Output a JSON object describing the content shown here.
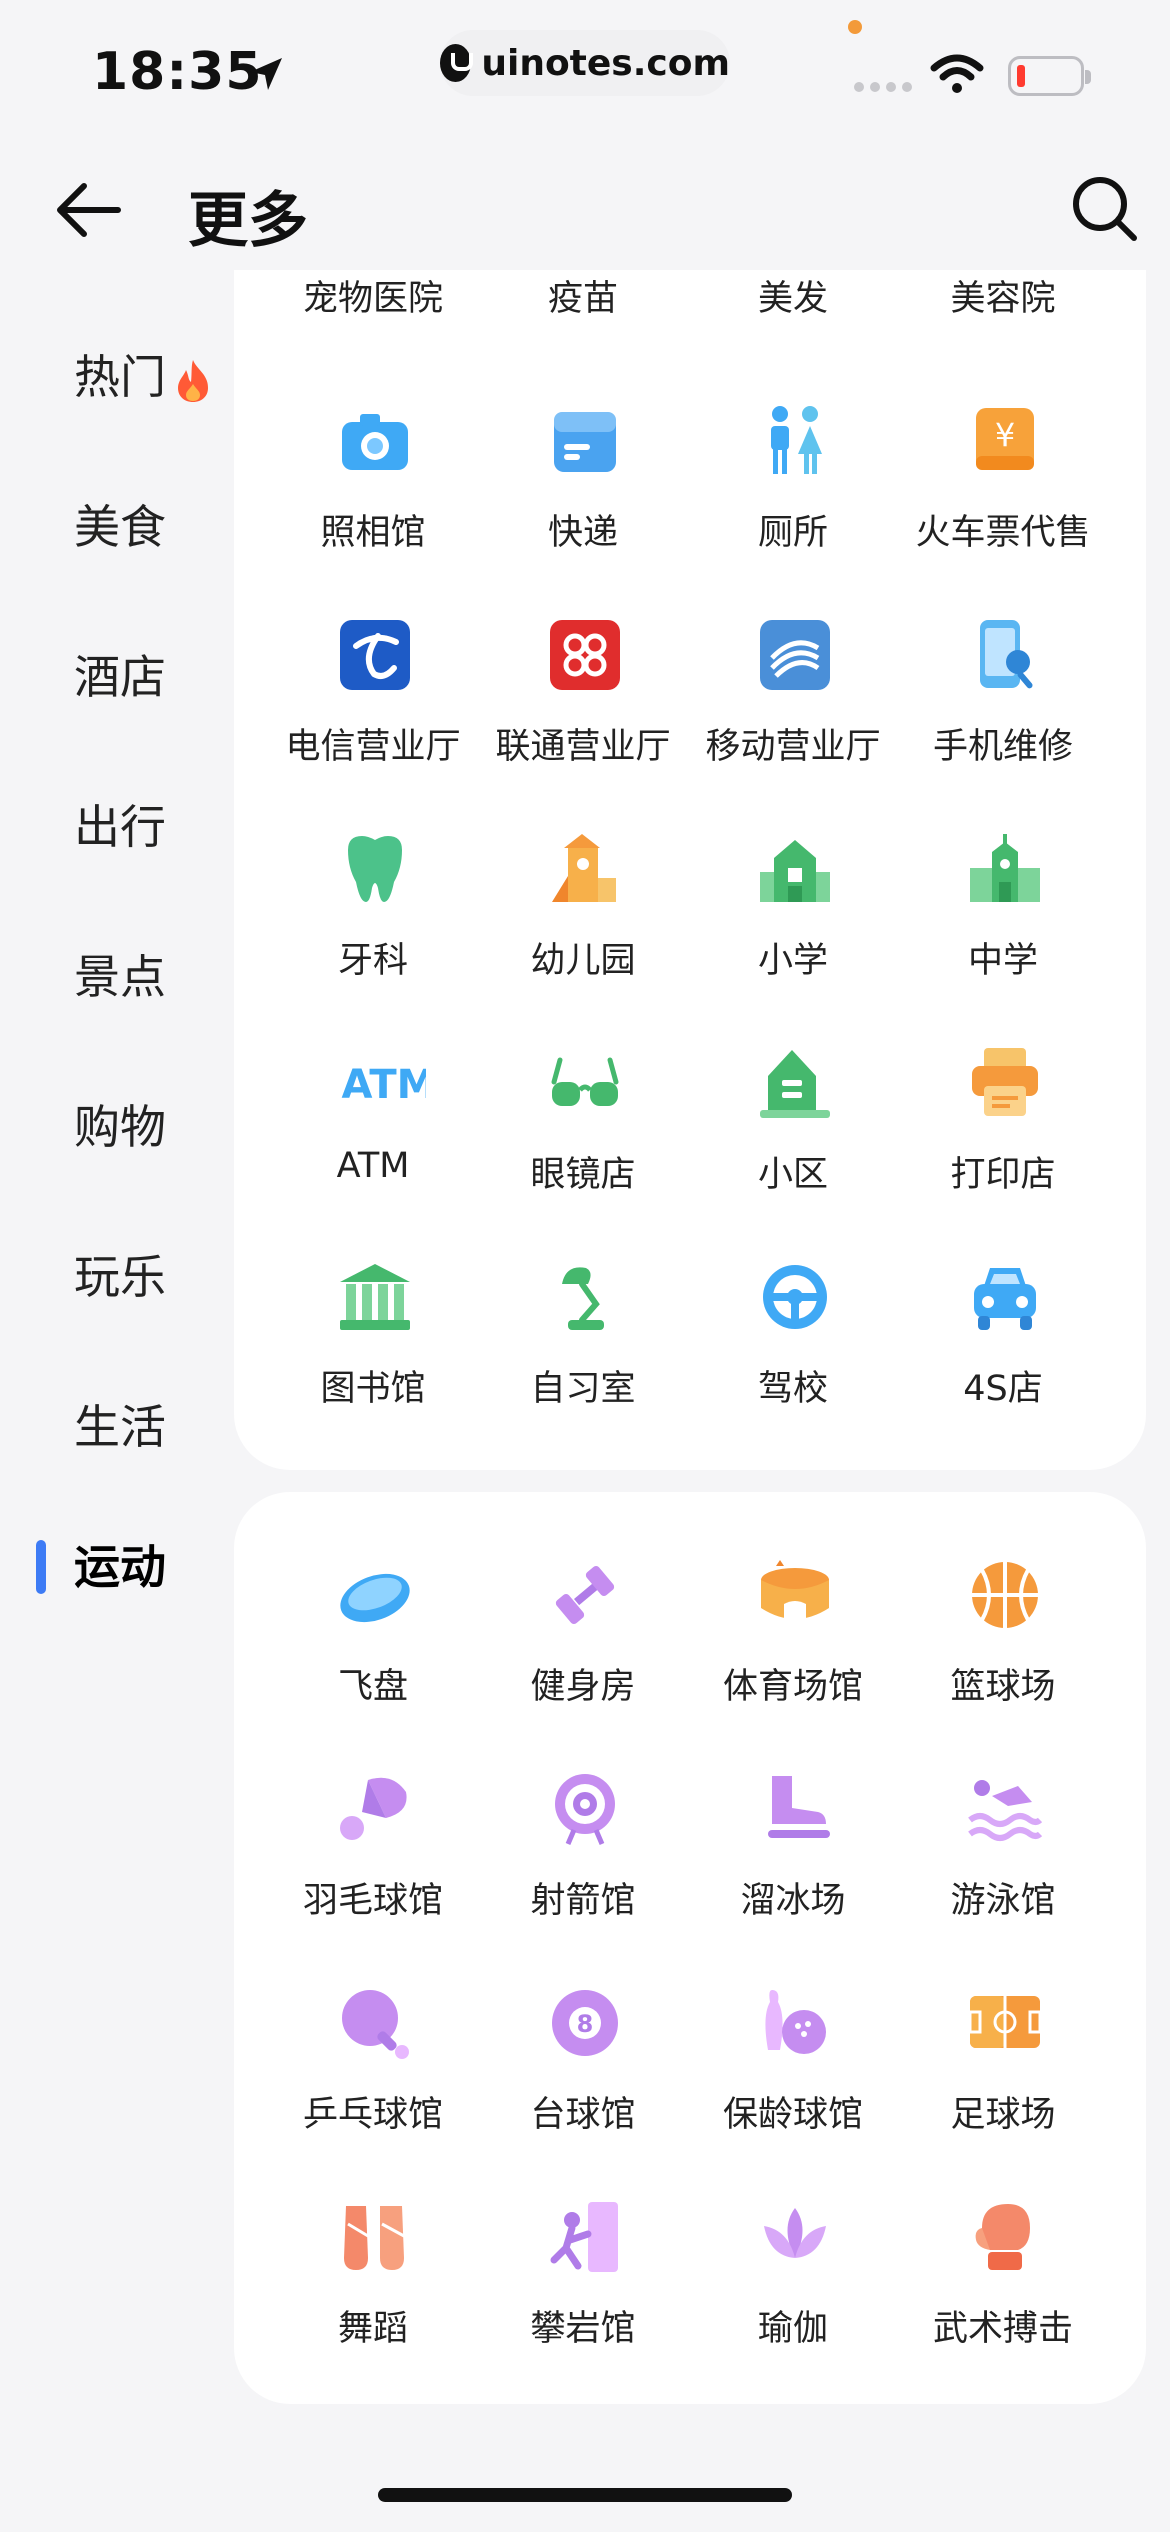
{
  "status_bar": {
    "time": "18:35",
    "url": "uinotes.com"
  },
  "header": {
    "title": "更多"
  },
  "sidebar": {
    "items": [
      {
        "label": "热门",
        "icon": "fire-icon"
      },
      {
        "label": "美食"
      },
      {
        "label": "酒店"
      },
      {
        "label": "出行"
      },
      {
        "label": "景点"
      },
      {
        "label": "购物"
      },
      {
        "label": "玩乐"
      },
      {
        "label": "生活"
      },
      {
        "label": "运动",
        "active": true
      }
    ]
  },
  "section_life": {
    "top_row": [
      "宠物医院",
      "疫苗",
      "美发",
      "美容院"
    ],
    "items": [
      {
        "label": "照相馆",
        "icon": "camera-icon"
      },
      {
        "label": "快递",
        "icon": "package-icon"
      },
      {
        "label": "厕所",
        "icon": "restroom-icon"
      },
      {
        "label": "火车票代售",
        "icon": "ticket-icon"
      },
      {
        "label": "电信营业厅",
        "icon": "telecom-icon"
      },
      {
        "label": "联通营业厅",
        "icon": "unicom-icon"
      },
      {
        "label": "移动营业厅",
        "icon": "mobile-icon"
      },
      {
        "label": "手机维修",
        "icon": "phone-repair-icon"
      },
      {
        "label": "牙科",
        "icon": "tooth-icon"
      },
      {
        "label": "幼儿园",
        "icon": "kindergarten-icon"
      },
      {
        "label": "小学",
        "icon": "primary-school-icon"
      },
      {
        "label": "中学",
        "icon": "middle-school-icon"
      },
      {
        "label": "ATM",
        "icon": "atm-icon"
      },
      {
        "label": "眼镜店",
        "icon": "glasses-icon"
      },
      {
        "label": "小区",
        "icon": "community-icon"
      },
      {
        "label": "打印店",
        "icon": "printer-icon"
      },
      {
        "label": "图书馆",
        "icon": "library-icon"
      },
      {
        "label": "自习室",
        "icon": "desk-lamp-icon"
      },
      {
        "label": "驾校",
        "icon": "steering-wheel-icon"
      },
      {
        "label": "4S店",
        "icon": "car-icon"
      }
    ]
  },
  "section_sports": {
    "items": [
      {
        "label": "飞盘",
        "icon": "frisbee-icon"
      },
      {
        "label": "健身房",
        "icon": "dumbbell-icon"
      },
      {
        "label": "体育场馆",
        "icon": "stadium-icon"
      },
      {
        "label": "篮球场",
        "icon": "basketball-icon"
      },
      {
        "label": "羽毛球馆",
        "icon": "shuttlecock-icon"
      },
      {
        "label": "射箭馆",
        "icon": "archery-target-icon"
      },
      {
        "label": "溜冰场",
        "icon": "skate-icon"
      },
      {
        "label": "游泳馆",
        "icon": "swimmer-icon"
      },
      {
        "label": "乒乓球馆",
        "icon": "ping-pong-icon"
      },
      {
        "label": "台球馆",
        "icon": "billiard-ball-icon"
      },
      {
        "label": "保龄球馆",
        "icon": "bowling-icon"
      },
      {
        "label": "足球场",
        "icon": "football-field-icon"
      },
      {
        "label": "舞蹈",
        "icon": "ballet-shoes-icon"
      },
      {
        "label": "攀岩馆",
        "icon": "climbing-icon"
      },
      {
        "label": "瑜伽",
        "icon": "lotus-icon"
      },
      {
        "label": "武术搏击",
        "icon": "boxing-glove-icon"
      }
    ]
  }
}
